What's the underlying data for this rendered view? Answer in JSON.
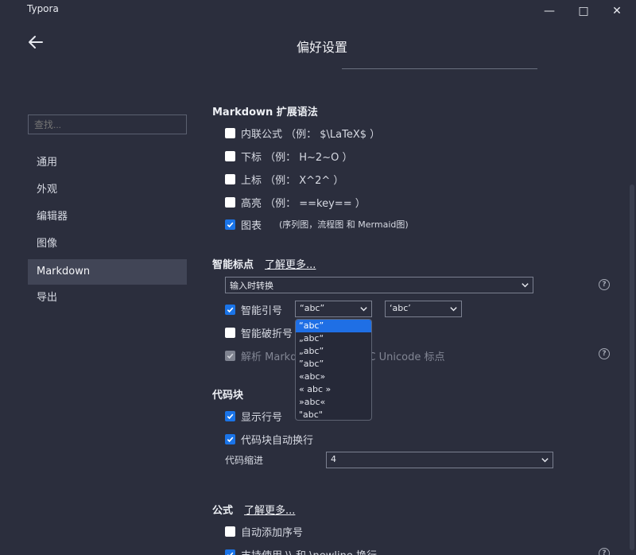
{
  "window": {
    "app_title": "Typora",
    "minimize": "—",
    "maximize": "□",
    "close": "✕"
  },
  "header": {
    "title": "偏好设置",
    "back_icon": "arrow-left-icon"
  },
  "sidebar": {
    "search_placeholder": "查找...",
    "items": [
      {
        "label": "通用",
        "active": false
      },
      {
        "label": "外观",
        "active": false
      },
      {
        "label": "编辑器",
        "active": false
      },
      {
        "label": "图像",
        "active": false
      },
      {
        "label": "Markdown",
        "active": true
      },
      {
        "label": "导出",
        "active": false
      }
    ]
  },
  "markdown_ext": {
    "title": "Markdown 扩展语法",
    "inline_math": {
      "label": "内联公式 （例： $\\LaTeX$ ）",
      "checked": false
    },
    "subscript": {
      "label": "下标 （例： H~2~O ）",
      "checked": false
    },
    "superscript": {
      "label": "上标 （例： X^2^ ）",
      "checked": false
    },
    "highlight": {
      "label": "高亮 （例： ==key== ）",
      "checked": false
    },
    "diagrams": {
      "label": "图表",
      "note": "(序列图，流程图 和 Mermaid图)",
      "checked": true
    }
  },
  "smart_punct": {
    "title": "智能标点",
    "learn_more": "了解更多...",
    "mode_value": "输入时转换",
    "smart_quotes": {
      "label": "智能引号",
      "checked": true,
      "double_value": "“abc”",
      "single_value": "‘abc’"
    },
    "smart_dash": {
      "label": "智能破折号",
      "checked": false
    },
    "parse_unicode": {
      "label_left": "解析 Markdo",
      "label_right": "C Unicode 标点",
      "checked": true,
      "disabled": true
    },
    "quote_options": [
      "“abc”",
      "„abc“",
      "„abc”",
      "”abc”",
      "«abc»",
      "« abc »",
      "»abc«",
      "\"abc\""
    ]
  },
  "code_block": {
    "title": "代码块",
    "line_numbers": {
      "label": "显示行号",
      "checked": true
    },
    "wrap": {
      "label": "代码块自动换行",
      "checked": true
    },
    "indent_label": "代码缩进",
    "indent_value": "4"
  },
  "math": {
    "title": "公式",
    "learn_more": "了解更多...",
    "auto_number": {
      "label": "自动添加序号",
      "checked": false
    },
    "newline": {
      "label": "支持使用 \\\\ 和 \\newline 换行",
      "checked": true
    }
  },
  "colors": {
    "background": "#2b2e3d",
    "accent": "#1a74e8",
    "active_nav": "#414556"
  }
}
